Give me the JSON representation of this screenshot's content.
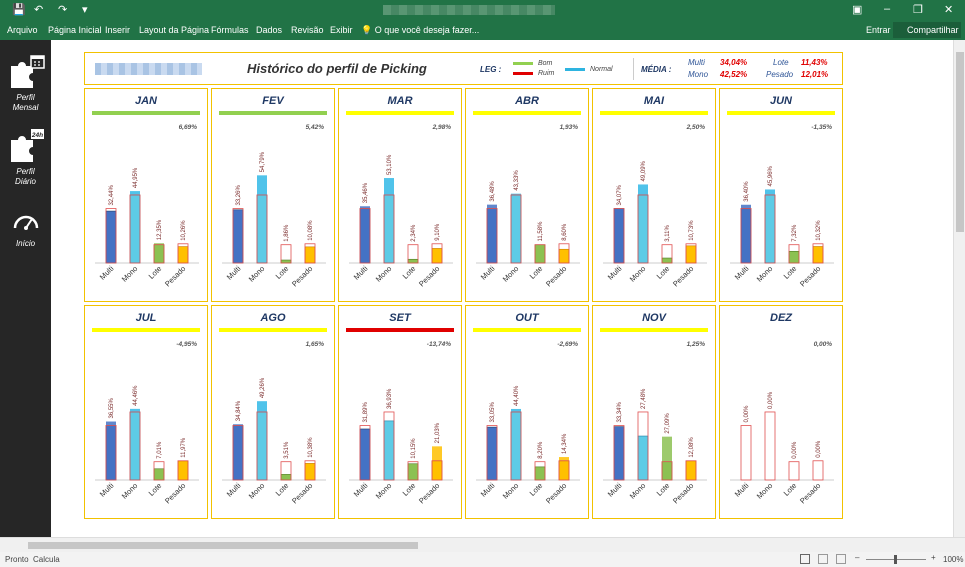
{
  "window": {
    "quick_access": [
      "💾",
      "↶",
      "↷",
      "▾"
    ],
    "controls": [
      "▣",
      "–",
      "❐",
      "✕"
    ]
  },
  "ribbon": {
    "tabs": [
      "Arquivo",
      "Página Inicial",
      "Inserir",
      "Layout da Página",
      "Fórmulas",
      "Dados",
      "Revisão",
      "Exibir"
    ],
    "tell_me": "O que você deseja fazer...",
    "signin": "Entrar",
    "share": "Compartilhar"
  },
  "sidebar": {
    "items": [
      {
        "label1": "Perfil",
        "label2": "Mensal",
        "icon": "puzzle-calendar-icon"
      },
      {
        "label1": "Perfil",
        "label2": "Diário",
        "icon": "puzzle-24h-icon",
        "badge": "24h"
      },
      {
        "label1": "Início",
        "label2": "",
        "icon": "speedometer-icon"
      }
    ]
  },
  "header": {
    "title": "Histórico do perfil de Picking",
    "leg_label": "LEG :",
    "legend": [
      {
        "label": "Bom",
        "color": "#92d050"
      },
      {
        "label": "Ruim",
        "color": "#e00000"
      },
      {
        "label": "Normal",
        "color": "#2eb4e0"
      }
    ],
    "media_label": "MÉDIA :",
    "media": [
      {
        "label": "Multi",
        "value": "34,04%"
      },
      {
        "label": "Mono",
        "value": "42,52%"
      },
      {
        "label": "Lote",
        "value": "11,43%"
      },
      {
        "label": "Pesado",
        "value": "12,01%"
      }
    ]
  },
  "status": {
    "left1": "Pronto",
    "left2": "Calcula",
    "zoom": "100%"
  },
  "chart_data": {
    "type": "bar",
    "categories": [
      "Multi",
      "Mono",
      "Lote",
      "Pesado"
    ],
    "months": [
      {
        "name": "JAN",
        "status_color": "#92d050",
        "pct": "6,69%",
        "values": [
          32.44,
          44.95,
          12.35,
          10.26
        ],
        "labels": [
          "32,44%",
          "44,95%",
          "12,35%",
          "10,26%"
        ]
      },
      {
        "name": "FEV",
        "status_color": "#92d050",
        "pct": "5,42%",
        "values": [
          33.26,
          54.79,
          1.86,
          10.08
        ],
        "labels": [
          "33,26%",
          "54,79%",
          "1,86%",
          "10,08%"
        ]
      },
      {
        "name": "MAR",
        "status_color": "#ffff00",
        "pct": "2,98%",
        "values": [
          35.46,
          53.1,
          2.34,
          9.1
        ],
        "labels": [
          "35,46%",
          "53,10%",
          "2,34%",
          "9,10%"
        ]
      },
      {
        "name": "ABR",
        "status_color": "#ffff00",
        "pct": "1,93%",
        "values": [
          36.48,
          43.33,
          11.58,
          8.6
        ],
        "labels": [
          "36,48%",
          "43,33%",
          "11,58%",
          "8,60%"
        ]
      },
      {
        "name": "MAI",
        "status_color": "#ffff00",
        "pct": "2,50%",
        "values": [
          34.07,
          49.09,
          3.11,
          10.73
        ],
        "labels": [
          "34,07%",
          "49,09%",
          "3,11%",
          "10,73%"
        ]
      },
      {
        "name": "JUN",
        "status_color": "#ffff00",
        "pct": "-1,35%",
        "values": [
          36.4,
          45.96,
          7.32,
          10.32
        ],
        "labels": [
          "36,40%",
          "45,96%",
          "7,32%",
          "10,32%"
        ]
      },
      {
        "name": "JUL",
        "status_color": "#ffff00",
        "pct": "-4,95%",
        "values": [
          36.55,
          44.46,
          7.01,
          11.97
        ],
        "labels": [
          "36,55%",
          "44,46%",
          "7,01%",
          "11,97%"
        ]
      },
      {
        "name": "AGO",
        "status_color": "#ffff00",
        "pct": "1,65%",
        "values": [
          34.84,
          49.26,
          3.51,
          10.38
        ],
        "labels": [
          "34,84%",
          "49,26%",
          "3,51%",
          "10,38%"
        ]
      },
      {
        "name": "SET",
        "status_color": "#e00000",
        "pct": "-13,74%",
        "values": [
          31.89,
          36.93,
          10.15,
          21.03
        ],
        "labels": [
          "31,89%",
          "36,93%",
          "10,15%",
          "21,03%"
        ]
      },
      {
        "name": "OUT",
        "status_color": "#ffff00",
        "pct": "-2,69%",
        "values": [
          33.05,
          44.4,
          8.2,
          14.34
        ],
        "labels": [
          "33,05%",
          "44,40%",
          "8,20%",
          "14,34%"
        ]
      },
      {
        "name": "NOV",
        "status_color": "#ffff00",
        "pct": "1,25%",
        "values": [
          33.34,
          27.48,
          27.09,
          12.08
        ],
        "labels": [
          "33,34%",
          "27,48%",
          "27,09%",
          "12,08%"
        ]
      },
      {
        "name": "DEZ",
        "status_color": "#ffffff",
        "pct": "0,00%",
        "values": [
          0,
          0,
          0,
          0
        ],
        "labels": [
          "0,00%",
          "0,00%",
          "0,00%",
          "0,00%"
        ]
      }
    ],
    "target": [
      34.04,
      42.52,
      11.43,
      12.01
    ],
    "ylim": [
      0,
      60
    ]
  }
}
